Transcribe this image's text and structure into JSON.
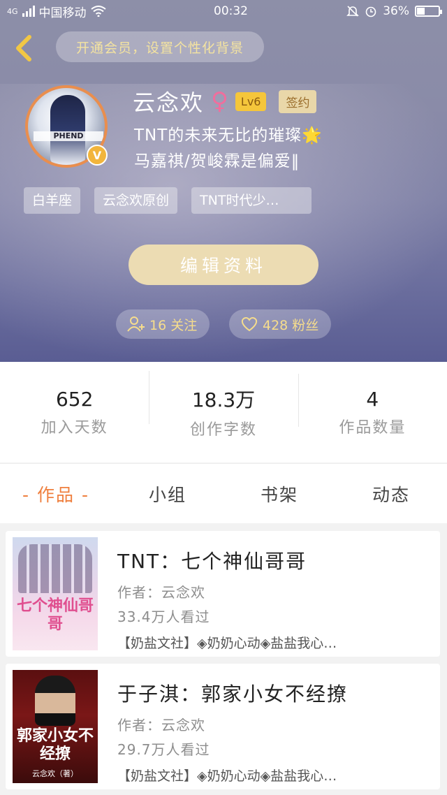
{
  "status_bar": {
    "network": "4G",
    "carrier": "中国移动",
    "time": "00:32",
    "battery": "36%",
    "battery_level": 0.36
  },
  "header": {
    "vip_banner": "开通会员，设置个性化背景"
  },
  "profile": {
    "avatar_text": "PHEND",
    "verified_badge": "V",
    "name": "云念欢",
    "gender_symbol": "♀",
    "level": "Lv6",
    "signed_badge": "签约",
    "bio_line1": "TNT的未来无比的璀璨🌟",
    "bio_line2": "马嘉祺/贺峻霖是偏爱‖",
    "tags": [
      "白羊座",
      "云念欢原创",
      "TNT时代少…"
    ],
    "edit_button": "编辑资料",
    "following": "16 关注",
    "followers": "428 粉丝"
  },
  "stats": [
    {
      "value": "652",
      "label": "加入天数"
    },
    {
      "value": "18.3万",
      "label": "创作字数"
    },
    {
      "value": "4",
      "label": "作品数量"
    }
  ],
  "tabs": [
    {
      "label": "- 作品 -",
      "active": true
    },
    {
      "label": "小组",
      "active": false
    },
    {
      "label": "书架",
      "active": false
    },
    {
      "label": "动态",
      "active": false
    }
  ],
  "books": [
    {
      "title": "TNT：七个神仙哥哥",
      "author": "作者：云念欢",
      "views": "33.4万人看过",
      "tags": "【奶盐文社】◈奶奶心动◈盐盐我心…",
      "cover_text": "七个神仙哥哥"
    },
    {
      "title": "于子淇：郭家小女不经撩",
      "author": "作者：云念欢",
      "views": "29.7万人看过",
      "tags": "【奶盐文社】◈奶奶心动◈盐盐我心…",
      "cover_text": "郭家小女不经撩",
      "cover_author": "云念欢（著）"
    }
  ],
  "colors": {
    "accent_orange": "#ef7f3e",
    "gold": "#f6dd8c",
    "avatar_ring": "#e98e4e"
  }
}
